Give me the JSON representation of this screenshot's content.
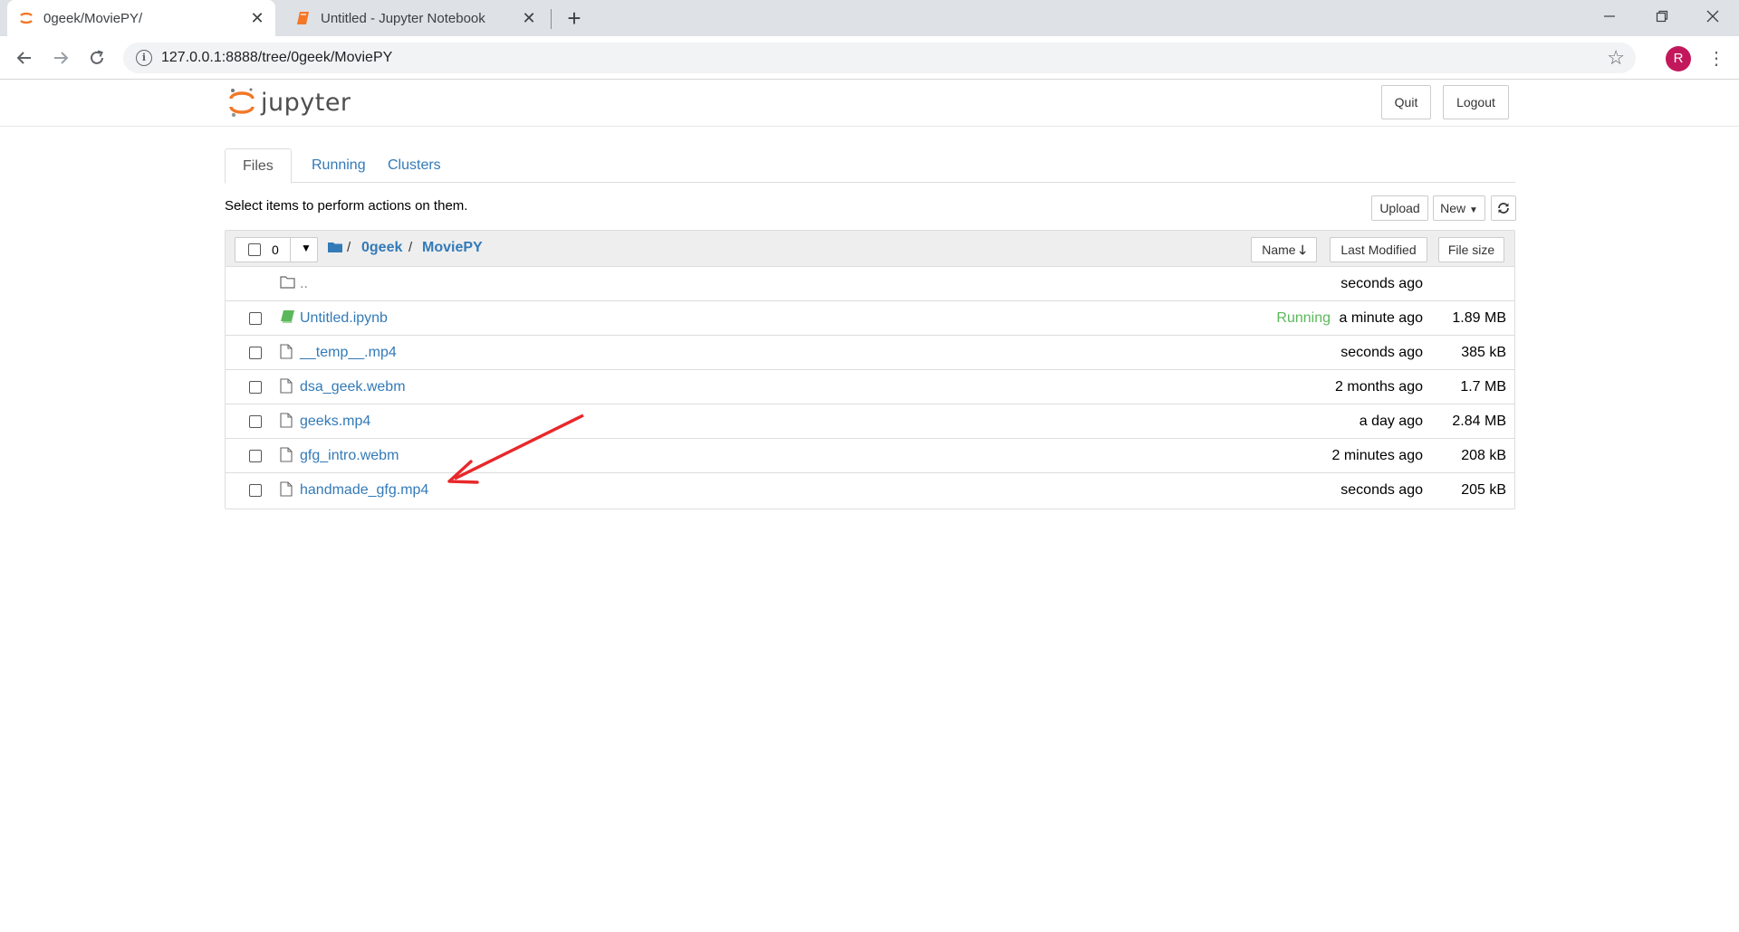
{
  "browser": {
    "tabs": [
      {
        "title": "0geek/MoviePY/",
        "active": true
      },
      {
        "title": "Untitled - Jupyter Notebook",
        "active": false
      }
    ],
    "url": "127.0.0.1:8888/tree/0geek/MoviePY",
    "profile_initial": "R",
    "profile_color": "#c2185b"
  },
  "header": {
    "logo_text": "jupyter",
    "quit_label": "Quit",
    "logout_label": "Logout"
  },
  "tabs": [
    {
      "label": "Files",
      "active": true
    },
    {
      "label": "Running",
      "active": false
    },
    {
      "label": "Clusters",
      "active": false
    }
  ],
  "toolbar": {
    "hint": "Select items to perform actions on them.",
    "upload_label": "Upload",
    "new_label": "New"
  },
  "list": {
    "selected_count": "0",
    "breadcrumb": [
      "0geek",
      "MoviePY"
    ],
    "columns": {
      "name": "Name",
      "modified": "Last Modified",
      "size": "File size"
    },
    "rows": [
      {
        "name": "..",
        "type": "folder",
        "status": "",
        "modified": "seconds ago",
        "size": ""
      },
      {
        "name": "Untitled.ipynb",
        "type": "notebook",
        "status": "Running",
        "modified": "a minute ago",
        "size": "1.89 MB"
      },
      {
        "name": "__temp__.mp4",
        "type": "file",
        "status": "",
        "modified": "seconds ago",
        "size": "385 kB"
      },
      {
        "name": "dsa_geek.webm",
        "type": "file",
        "status": "",
        "modified": "2 months ago",
        "size": "1.7 MB"
      },
      {
        "name": "geeks.mp4",
        "type": "file",
        "status": "",
        "modified": "a day ago",
        "size": "2.84 MB"
      },
      {
        "name": "gfg_intro.webm",
        "type": "file",
        "status": "",
        "modified": "2 minutes ago",
        "size": "208 kB"
      },
      {
        "name": "handmade_gfg.mp4",
        "type": "file",
        "status": "",
        "modified": "seconds ago",
        "size": "205 kB"
      }
    ]
  },
  "colors": {
    "link": "#337ab7",
    "running": "#5cb85c",
    "annotation_arrow": "#e8282b",
    "jupyter_orange": "#f37726"
  }
}
